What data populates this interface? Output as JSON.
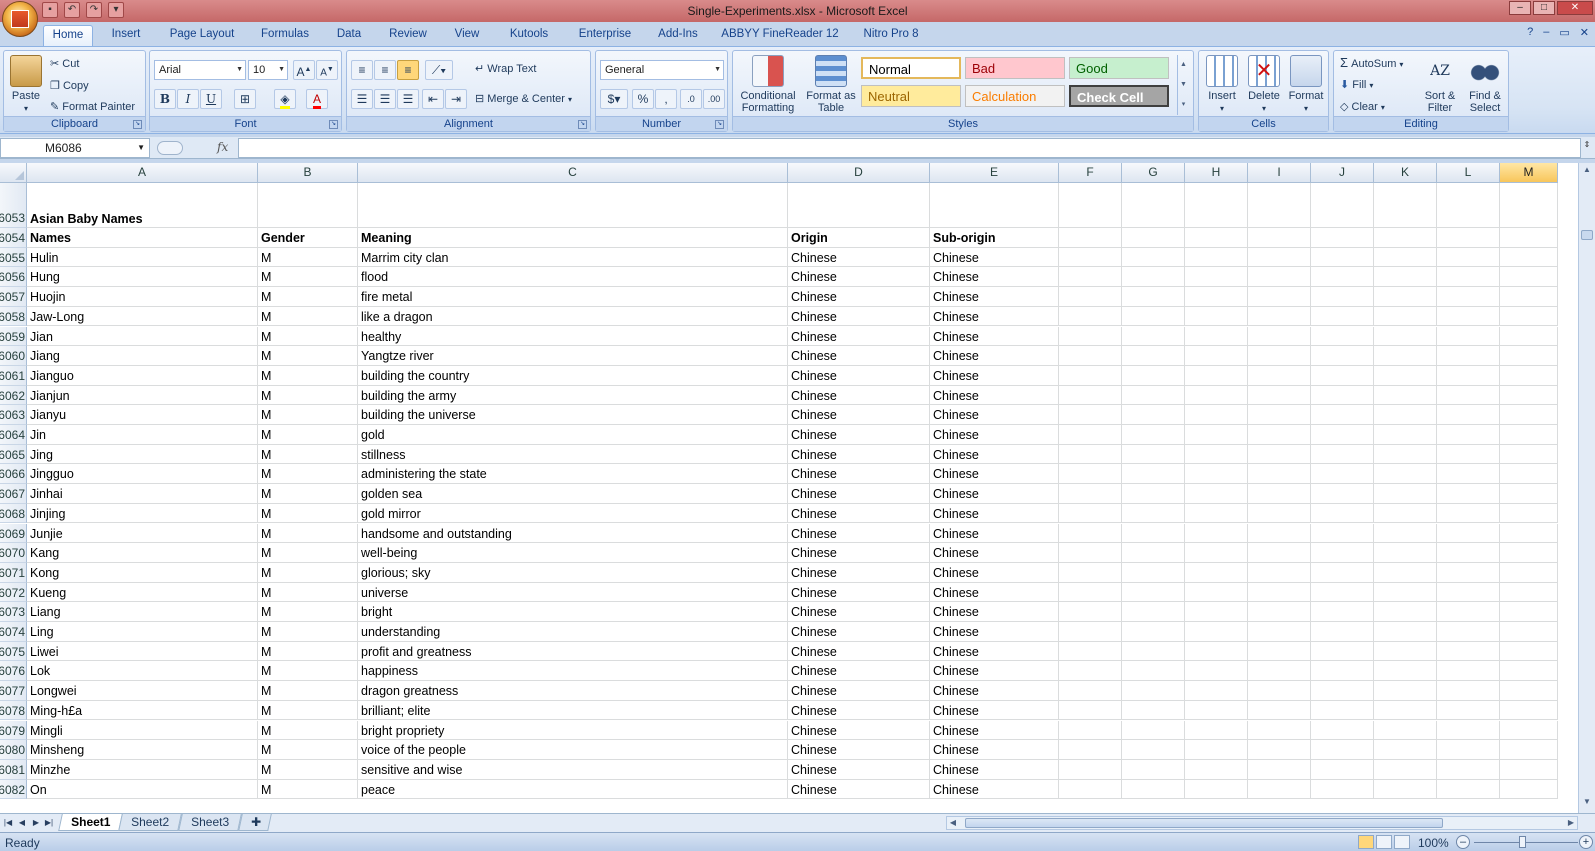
{
  "window": {
    "title": "Single-Experiments.xlsx - Microsoft Excel"
  },
  "ribbon_tabs": [
    "Home",
    "Insert",
    "Page Layout",
    "Formulas",
    "Data",
    "Review",
    "View",
    "Kutools",
    "Enterprise",
    "Add-Ins",
    "ABBYY FineReader 12",
    "Nitro Pro 8"
  ],
  "clipboard": {
    "label": "Clipboard",
    "paste": "Paste",
    "cut": "Cut",
    "copy": "Copy",
    "format_painter": "Format Painter"
  },
  "font": {
    "label": "Font",
    "name": "Arial",
    "size": "10"
  },
  "alignment": {
    "label": "Alignment",
    "wrap_text": "Wrap Text",
    "merge_center": "Merge & Center"
  },
  "number": {
    "label": "Number",
    "format": "General"
  },
  "styles": {
    "label": "Styles",
    "conditional_formatting": "Conditional Formatting",
    "format_as_table": "Format as Table",
    "cells": [
      {
        "text": "Normal",
        "bg": "#ffffff",
        "fg": "#000000"
      },
      {
        "text": "Bad",
        "bg": "#ffc7ce",
        "fg": "#9c0006"
      },
      {
        "text": "Good",
        "bg": "#c6efce",
        "fg": "#006100"
      },
      {
        "text": "Neutral",
        "bg": "#ffeb9c",
        "fg": "#9c6500"
      },
      {
        "text": "Calculation",
        "bg": "#f2f2f2",
        "fg": "#fa7d00"
      },
      {
        "text": "Check Cell",
        "bg": "#a5a5a5",
        "fg": "#ffffff"
      }
    ]
  },
  "cells_group": {
    "label": "Cells",
    "insert": "Insert",
    "delete": "Delete",
    "format": "Format"
  },
  "editing": {
    "label": "Editing",
    "autosum": "AutoSum",
    "fill": "Fill",
    "clear": "Clear",
    "sort_filter": "Sort & Filter",
    "find_select": "Find & Select"
  },
  "formula_bar": {
    "name_box": "M6086",
    "fx": "fx",
    "value": ""
  },
  "columns": [
    "A",
    "B",
    "C",
    "D",
    "E",
    "F",
    "G",
    "H",
    "I",
    "J",
    "K",
    "L",
    "M"
  ],
  "selected_column": "M",
  "rows": [
    {
      "n": "6053",
      "cells": [
        "Asian Baby Names",
        "",
        "",
        "",
        ""
      ],
      "bold": true
    },
    {
      "n": "6054",
      "cells": [
        "Names",
        "Gender",
        "Meaning",
        "Origin",
        "Sub-origin"
      ],
      "bold": true
    },
    {
      "n": "6055",
      "cells": [
        "Hulin",
        "M",
        "Marrim city clan",
        "Chinese",
        "Chinese"
      ]
    },
    {
      "n": "6056",
      "cells": [
        "Hung",
        "M",
        "flood",
        "Chinese",
        "Chinese"
      ]
    },
    {
      "n": "6057",
      "cells": [
        "Huojin",
        "M",
        "fire metal",
        "Chinese",
        "Chinese"
      ]
    },
    {
      "n": "6058",
      "cells": [
        "Jaw-Long",
        "M",
        "like a dragon",
        "Chinese",
        "Chinese"
      ]
    },
    {
      "n": "6059",
      "cells": [
        "Jian",
        "M",
        "healthy",
        "Chinese",
        "Chinese"
      ]
    },
    {
      "n": "6060",
      "cells": [
        "Jiang",
        "M",
        "Yangtze river",
        "Chinese",
        "Chinese"
      ]
    },
    {
      "n": "6061",
      "cells": [
        "Jianguo",
        "M",
        "building the country",
        "Chinese",
        "Chinese"
      ]
    },
    {
      "n": "6062",
      "cells": [
        "Jianjun",
        "M",
        "building the army",
        "Chinese",
        "Chinese"
      ]
    },
    {
      "n": "6063",
      "cells": [
        "Jianyu",
        "M",
        "building the universe",
        "Chinese",
        "Chinese"
      ]
    },
    {
      "n": "6064",
      "cells": [
        "Jin",
        "M",
        "gold",
        "Chinese",
        "Chinese"
      ]
    },
    {
      "n": "6065",
      "cells": [
        "Jing",
        "M",
        "stillness",
        "Chinese",
        "Chinese"
      ]
    },
    {
      "n": "6066",
      "cells": [
        "Jingguo",
        "M",
        "administering the state",
        "Chinese",
        "Chinese"
      ]
    },
    {
      "n": "6067",
      "cells": [
        "Jinhai",
        "M",
        "golden sea",
        "Chinese",
        "Chinese"
      ]
    },
    {
      "n": "6068",
      "cells": [
        "Jinjing",
        "M",
        "gold mirror",
        "Chinese",
        "Chinese"
      ]
    },
    {
      "n": "6069",
      "cells": [
        "Junjie",
        "M",
        "handsome and outstanding",
        "Chinese",
        "Chinese"
      ]
    },
    {
      "n": "6070",
      "cells": [
        "Kang",
        "M",
        "well-being",
        "Chinese",
        "Chinese"
      ]
    },
    {
      "n": "6071",
      "cells": [
        "Kong",
        "M",
        "glorious; sky",
        "Chinese",
        "Chinese"
      ]
    },
    {
      "n": "6072",
      "cells": [
        "Kueng",
        "M",
        "universe",
        "Chinese",
        "Chinese"
      ]
    },
    {
      "n": "6073",
      "cells": [
        "Liang",
        "M",
        "bright",
        "Chinese",
        "Chinese"
      ]
    },
    {
      "n": "6074",
      "cells": [
        "Ling",
        "M",
        "understanding",
        "Chinese",
        "Chinese"
      ]
    },
    {
      "n": "6075",
      "cells": [
        "Liwei",
        "M",
        "profit and greatness",
        "Chinese",
        "Chinese"
      ]
    },
    {
      "n": "6076",
      "cells": [
        "Lok",
        "M",
        "happiness",
        "Chinese",
        "Chinese"
      ]
    },
    {
      "n": "6077",
      "cells": [
        "Longwei",
        "M",
        "dragon greatness",
        "Chinese",
        "Chinese"
      ]
    },
    {
      "n": "6078",
      "cells": [
        "Ming-h£a",
        "M",
        "brilliant; elite",
        "Chinese",
        "Chinese"
      ]
    },
    {
      "n": "6079",
      "cells": [
        "Mingli",
        "M",
        "bright propriety",
        "Chinese",
        "Chinese"
      ]
    },
    {
      "n": "6080",
      "cells": [
        "Minsheng",
        "M",
        "voice of the people",
        "Chinese",
        "Chinese"
      ]
    },
    {
      "n": "6081",
      "cells": [
        "Minzhe",
        "M",
        "sensitive and wise",
        "Chinese",
        "Chinese"
      ]
    },
    {
      "n": "6082",
      "cells": [
        "On",
        "M",
        "peace",
        "Chinese",
        "Chinese"
      ]
    }
  ],
  "sheets": [
    "Sheet1",
    "Sheet2",
    "Sheet3"
  ],
  "active_sheet": "Sheet1",
  "status": {
    "ready": "Ready",
    "zoom": "100%"
  }
}
